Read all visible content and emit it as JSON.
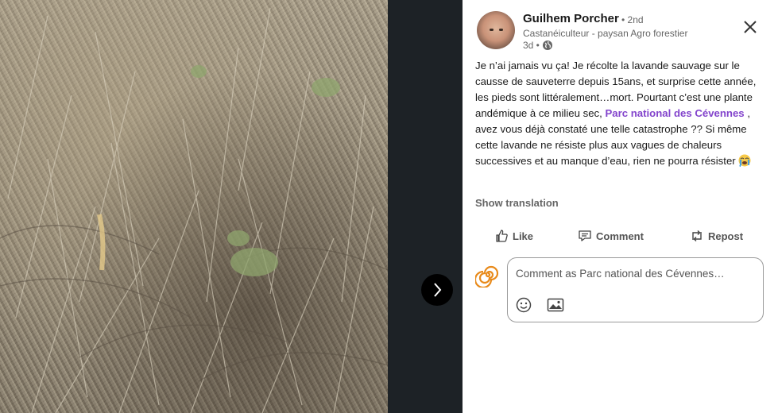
{
  "photo": {
    "icon": "lavender-field-photo"
  },
  "navigation": {
    "next_icon": "chevron-right-icon"
  },
  "author": {
    "name": "Guilhem Porcher",
    "degree": "• 2nd",
    "headline": "Castanéiculteur - paysan Agro forestier",
    "time": "3d •",
    "visibility_icon": "globe-icon"
  },
  "post": {
    "text_before": "Je n’ai jamais vu ça! Je récolte la lavande sauvage sur le causse de sauveterre depuis 15ans, et surprise cette année, les pieds sont littéralement…mort. Pourtant c’est une plante andémique à ce milieu sec, ",
    "mention": "Parc national des Cévennes",
    "text_after": " , avez vous déjà constaté une telle catastrophe ?? Si même cette lavande ne résiste plus aux vagues de chaleurs successives et au manque d’eau, rien ne pourra résister ",
    "emoji": "crying-face-emoji"
  },
  "show_translation": "Show translation",
  "actions": {
    "like": "Like",
    "comment": "Comment",
    "repost": "Repost"
  },
  "comment_box": {
    "placeholder": "Comment as Parc national des Cévennes…",
    "emoji_icon": "smiley-icon",
    "image_icon": "image-icon"
  },
  "colors": {
    "mention": "#8344cc",
    "background_dark": "#1d2226"
  }
}
